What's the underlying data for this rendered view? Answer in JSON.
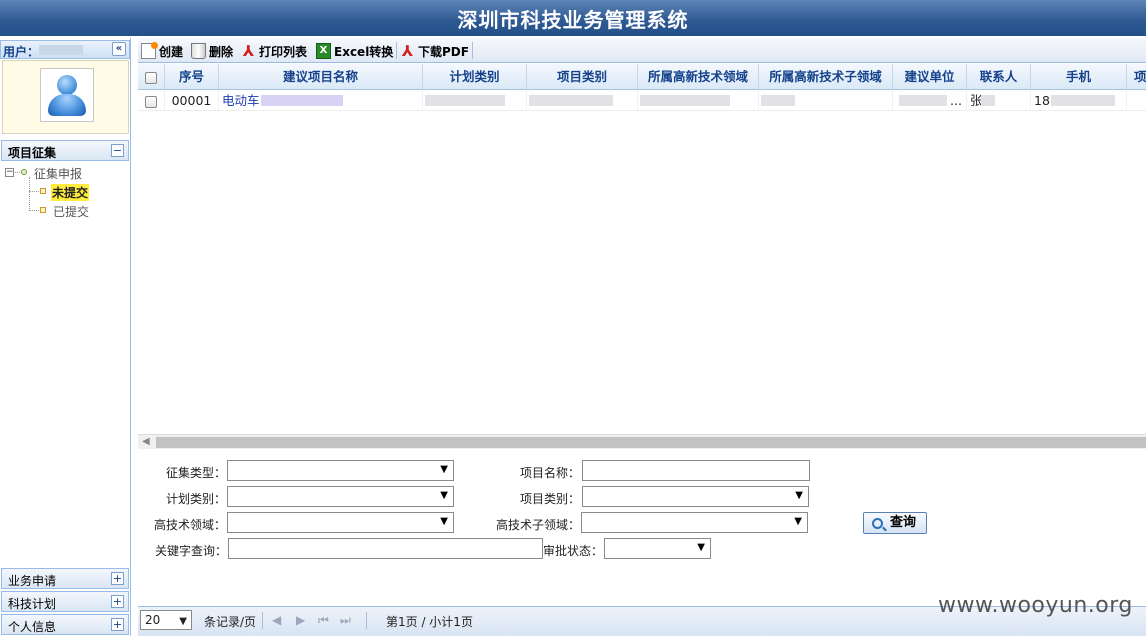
{
  "app": {
    "title": "深圳市科技业务管理系统"
  },
  "sidebar": {
    "user_label": "用户：",
    "collapse_glyph": "«",
    "project_panel": {
      "title": "项目征集",
      "toggle": "−"
    },
    "tree": {
      "root": "征集申报",
      "root_toggle": "−",
      "children": [
        {
          "label": "未提交",
          "selected": true
        },
        {
          "label": "已提交",
          "selected": false
        }
      ]
    },
    "bottom_panels": [
      {
        "title": "业务申请",
        "toggle": "+"
      },
      {
        "title": "科技计划",
        "toggle": "+"
      },
      {
        "title": "个人信息",
        "toggle": "+"
      }
    ]
  },
  "toolbar": {
    "create": "创建",
    "delete": "删除",
    "print": "打印列表",
    "excel": "Excel转换",
    "pdf": "下载PDF"
  },
  "grid": {
    "columns": [
      "序号",
      "建议项目名称",
      "计划类别",
      "项目类别",
      "所属高新技术领域",
      "所属高新技术子领域",
      "建议单位",
      "联系人",
      "手机",
      "项"
    ],
    "rows": [
      {
        "no": "00001",
        "name": "电动车",
        "unit_suffix": "...",
        "contact": "张",
        "phone": "18"
      }
    ]
  },
  "form": {
    "collect_type": "征集类型：",
    "project_name": "项目名称：",
    "plan_category": "计划类别：",
    "project_category": "项目类别：",
    "tech_field": "高技术领域：",
    "tech_subfield": "高技术子领域：",
    "keyword": "关键字查询：",
    "approval_status": "审批状态：",
    "query_button": "查询",
    "select_arrow": "▼"
  },
  "pager": {
    "page_size": "20",
    "records_per_page": "条记录/页",
    "first": "⏮",
    "prev": "◀",
    "next": "▶",
    "last": "⏭",
    "page_info": "第1页 / 小计1页"
  },
  "watermark": "www.wooyun.org"
}
